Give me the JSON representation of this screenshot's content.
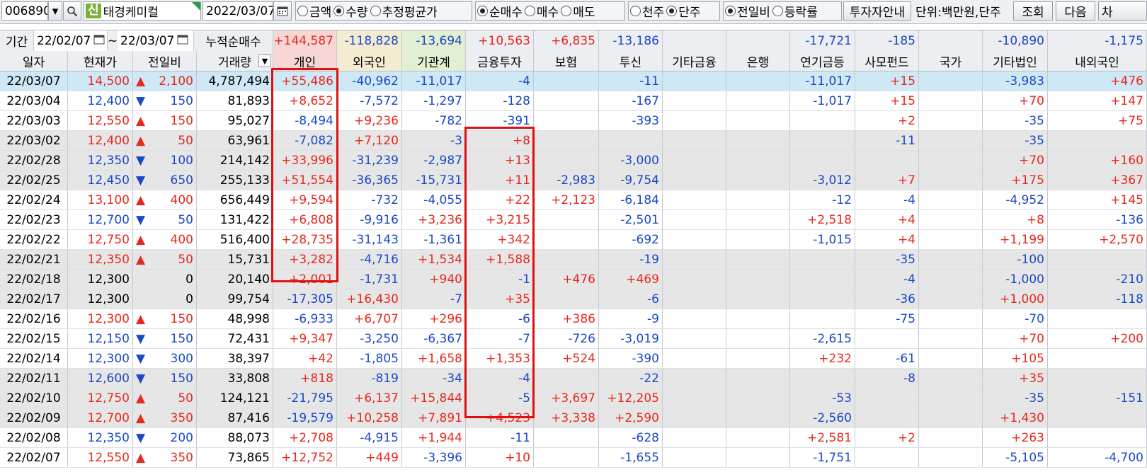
{
  "toolbar": {
    "code": "006890",
    "stock_name": "태경케미컬",
    "shin_badge": "신",
    "date": "2022/03/07",
    "radio_amount": "금액",
    "radio_qty": "수량",
    "radio_est": "추정평균가",
    "radio_net": "순매수",
    "radio_buy": "매수",
    "radio_sell": "매도",
    "radio_thousand": "천주",
    "radio_single": "단주",
    "radio_prev": "전일비",
    "radio_rate": "등락률",
    "investor_guide": "투자자안내",
    "unit": "단위:백만원,단주",
    "query": "조회",
    "next": "다음",
    "cut": "차"
  },
  "period": {
    "label": "기간",
    "from": "22/02/07",
    "tilde": "~",
    "to": "22/03/07",
    "cum_label": "누적순매수",
    "cum_values": [
      "+144,587",
      "-118,828",
      "-13,694",
      "+10,563",
      "+6,835",
      "-13,186",
      "",
      "",
      "-17,721",
      "-185",
      "",
      "-10,890",
      "-1,175"
    ]
  },
  "columns": [
    "일자",
    "현재가",
    "전일비",
    "거래량",
    "개인",
    "외국인",
    "기관계",
    "금융투자",
    "보험",
    "투신",
    "기타금융",
    "은행",
    "연기금등",
    "사모펀드",
    "국가",
    "기타법인",
    "내외국인"
  ],
  "rows": [
    {
      "date": "22/03/07",
      "price": "14,500",
      "dir": "up",
      "chg": "2,100",
      "vol": "4,787,494",
      "v": [
        "+55,486",
        "-40,962",
        "-11,017",
        "-4",
        "",
        "-11",
        "",
        "",
        "-11,017",
        "+15",
        "",
        "-3,983",
        "+476"
      ]
    },
    {
      "date": "22/03/04",
      "price": "12,400",
      "dir": "down",
      "chg": "150",
      "vol": "81,893",
      "v": [
        "+8,652",
        "-7,572",
        "-1,297",
        "-128",
        "",
        "-167",
        "",
        "",
        "-1,017",
        "+15",
        "",
        "+70",
        "+147"
      ]
    },
    {
      "date": "22/03/03",
      "price": "12,550",
      "dir": "up",
      "chg": "150",
      "vol": "95,027",
      "v": [
        "-8,494",
        "+9,236",
        "-782",
        "-391",
        "",
        "-393",
        "",
        "",
        "",
        "+2",
        "",
        "-35",
        "+75"
      ]
    },
    {
      "date": "22/03/02",
      "price": "12,400",
      "dir": "up",
      "chg": "50",
      "vol": "63,961",
      "v": [
        "-7,082",
        "+7,120",
        "-3",
        "+8",
        "",
        "",
        "",
        "",
        "",
        "-11",
        "",
        "-35",
        ""
      ]
    },
    {
      "date": "22/02/28",
      "price": "12,350",
      "dir": "down",
      "chg": "100",
      "vol": "214,142",
      "v": [
        "+33,996",
        "-31,239",
        "-2,987",
        "+13",
        "",
        "-3,000",
        "",
        "",
        "",
        "",
        "",
        "+70",
        "+160"
      ]
    },
    {
      "date": "22/02/25",
      "price": "12,450",
      "dir": "down",
      "chg": "650",
      "vol": "255,133",
      "v": [
        "+51,554",
        "-36,365",
        "-15,731",
        "+11",
        "-2,983",
        "-9,754",
        "",
        "",
        "-3,012",
        "+7",
        "",
        "+175",
        "+367"
      ]
    },
    {
      "date": "22/02/24",
      "price": "13,100",
      "dir": "up",
      "chg": "400",
      "vol": "656,449",
      "v": [
        "+9,594",
        "-732",
        "-4,055",
        "+22",
        "+2,123",
        "-6,184",
        "",
        "",
        "-12",
        "-4",
        "",
        "-4,952",
        "+145"
      ]
    },
    {
      "date": "22/02/23",
      "price": "12,700",
      "dir": "down",
      "chg": "50",
      "vol": "131,422",
      "v": [
        "+6,808",
        "-9,916",
        "+3,236",
        "+3,215",
        "",
        "-2,501",
        "",
        "",
        "+2,518",
        "+4",
        "",
        "+8",
        "-136"
      ]
    },
    {
      "date": "22/02/22",
      "price": "12,750",
      "dir": "up",
      "chg": "400",
      "vol": "516,400",
      "v": [
        "+28,735",
        "-31,143",
        "-1,361",
        "+342",
        "",
        "-692",
        "",
        "",
        "-1,015",
        "+4",
        "",
        "+1,199",
        "+2,570"
      ]
    },
    {
      "date": "22/02/21",
      "price": "12,350",
      "dir": "up",
      "chg": "50",
      "vol": "15,731",
      "v": [
        "+3,282",
        "-4,716",
        "+1,534",
        "+1,588",
        "",
        "-19",
        "",
        "",
        "",
        "-35",
        "",
        "-100",
        ""
      ]
    },
    {
      "date": "22/02/18",
      "price": "12,300",
      "dir": "none",
      "chg": "0",
      "vol": "20,140",
      "v": [
        "+2,001",
        "-1,731",
        "+940",
        "-1",
        "+476",
        "+469",
        "",
        "",
        "",
        "-4",
        "",
        "-1,000",
        "-210"
      ]
    },
    {
      "date": "22/02/17",
      "price": "12,300",
      "dir": "none",
      "chg": "0",
      "vol": "99,754",
      "v": [
        "-17,305",
        "+16,430",
        "-7",
        "+35",
        "",
        "-6",
        "",
        "",
        "",
        "-36",
        "",
        "+1,000",
        "-118"
      ]
    },
    {
      "date": "22/02/16",
      "price": "12,300",
      "dir": "up",
      "chg": "150",
      "vol": "48,998",
      "v": [
        "-6,933",
        "+6,707",
        "+296",
        "-6",
        "+386",
        "-9",
        "",
        "",
        "",
        "-75",
        "",
        "-70",
        ""
      ]
    },
    {
      "date": "22/02/15",
      "price": "12,150",
      "dir": "down",
      "chg": "150",
      "vol": "72,431",
      "v": [
        "+9,347",
        "-3,250",
        "-6,367",
        "-7",
        "-726",
        "-3,019",
        "",
        "",
        "-2,615",
        "",
        "",
        "+70",
        "+200"
      ]
    },
    {
      "date": "22/02/14",
      "price": "12,300",
      "dir": "down",
      "chg": "300",
      "vol": "38,397",
      "v": [
        "+42",
        "-1,805",
        "+1,658",
        "+1,353",
        "+524",
        "-390",
        "",
        "",
        "+232",
        "-61",
        "",
        "+105",
        ""
      ]
    },
    {
      "date": "22/02/11",
      "price": "12,600",
      "dir": "down",
      "chg": "150",
      "vol": "33,808",
      "v": [
        "+818",
        "-819",
        "-34",
        "-4",
        "",
        "-22",
        "",
        "",
        "",
        "-8",
        "",
        "+35",
        ""
      ]
    },
    {
      "date": "22/02/10",
      "price": "12,750",
      "dir": "up",
      "chg": "50",
      "vol": "124,121",
      "v": [
        "-21,795",
        "+6,137",
        "+15,844",
        "-5",
        "+3,697",
        "+12,205",
        "",
        "",
        "-53",
        "",
        "",
        "-35",
        "-151"
      ]
    },
    {
      "date": "22/02/09",
      "price": "12,700",
      "dir": "up",
      "chg": "350",
      "vol": "87,416",
      "v": [
        "-19,579",
        "+10,258",
        "+7,891",
        "+4,523",
        "+3,338",
        "+2,590",
        "",
        "",
        "-2,560",
        "",
        "",
        "+1,430",
        ""
      ]
    },
    {
      "date": "22/02/08",
      "price": "12,350",
      "dir": "down",
      "chg": "200",
      "vol": "88,073",
      "v": [
        "+2,708",
        "-4,915",
        "+1,944",
        "-11",
        "",
        "-628",
        "",
        "",
        "+2,581",
        "+2",
        "",
        "+263",
        ""
      ]
    },
    {
      "date": "22/02/07",
      "price": "12,550",
      "dir": "up",
      "chg": "350",
      "vol": "73,865",
      "v": [
        "+12,752",
        "+449",
        "-3,396",
        "+10",
        "",
        "-1,655",
        "",
        "",
        "-1,751",
        "",
        "",
        "-5,105",
        "-4,700"
      ]
    }
  ],
  "colors": {
    "up": "#e8281e",
    "down": "#1a49c8",
    "selected_row": "#cfe8f6",
    "band": "#e6e6e6",
    "personal_header": "#f7d6d6",
    "foreign_header": "#f3ecd0",
    "inst_header": "#e3efd3",
    "highlight_box": "#e01010"
  },
  "icons": {
    "dropdown": "chevron-down-icon",
    "search": "search-icon",
    "calendar": "calendar-icon"
  }
}
